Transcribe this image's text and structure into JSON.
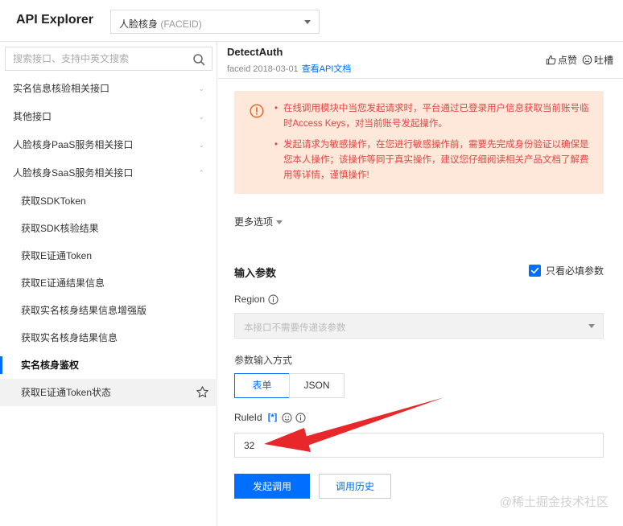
{
  "header": {
    "app_title": "API Explorer",
    "product_select": {
      "label": "人脸核身",
      "sub_label": "(FACEID)"
    }
  },
  "sidebar": {
    "search_placeholder": "搜索接口、支持中英文搜索",
    "categories": [
      {
        "label": "实名信息核验相关接口",
        "chevron": "⌄"
      },
      {
        "label": "其他接口",
        "chevron": "⌄"
      },
      {
        "label": "人脸核身PaaS服务相关接口",
        "chevron": "⌄"
      },
      {
        "label": "人脸核身SaaS服务相关接口",
        "chevron": "⌃"
      }
    ],
    "items": [
      {
        "label": "获取SDKToken"
      },
      {
        "label": "获取SDK核验结果"
      },
      {
        "label": "获取E证通Token"
      },
      {
        "label": "获取E证通结果信息"
      },
      {
        "label": "获取实名核身结果信息增强版"
      },
      {
        "label": "获取实名核身结果信息"
      },
      {
        "label": "实名核身鉴权"
      },
      {
        "label": "获取E证通Token状态"
      }
    ]
  },
  "api": {
    "name": "DetectAuth",
    "meta": "faceid 2018-03-01",
    "doc_link": "查看API文档",
    "like_label": "点赞",
    "complain_label": "吐槽"
  },
  "alert": {
    "color": "#e54545",
    "messages": [
      "在线调用模块中当您发起请求时，平台通过已登录用户信息获取当前账号临时Access Keys，对当前账号发起操作。",
      "发起请求为敏感操作，在您进行敏感操作前，需要先完成身份验证以确保是您本人操作；该操作等同于真实操作，建议您仔细阅读相关产品文档了解费用等详情，谨慎操作!"
    ]
  },
  "more_options": "更多选项",
  "params": {
    "title": "输入参数",
    "required_only": "只看必填参数",
    "region_label": "Region",
    "region_placeholder": "本接口不需要传递该参数",
    "input_mode_label": "参数输入方式",
    "mode_form": "表单",
    "mode_json": "JSON",
    "ruleid_label": "RuleId",
    "ruleid_required_tag": "[*]",
    "ruleid_value": "32"
  },
  "actions": {
    "invoke": "发起调用",
    "history": "调用历史"
  },
  "watermark": "@稀土掘金技术社区",
  "colors": {
    "primary": "#006eff",
    "alert_bg": "#fde8d9",
    "arrow": "#e8272a"
  }
}
